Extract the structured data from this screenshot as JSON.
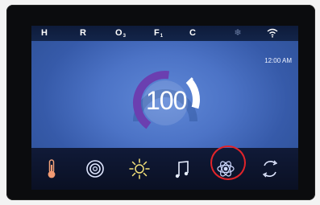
{
  "status_bar": {
    "h": "H",
    "r": "R",
    "o": "O",
    "o_sub": "3",
    "f": "F",
    "f_sub": "1",
    "c": "C",
    "snow_icon": "snowflake-icon",
    "wifi_icon": "wifi-icon"
  },
  "clock": {
    "time": "12:00 AM"
  },
  "temperature": {
    "value": "100",
    "gauge_level_percent": 60,
    "accent_color": "#6b3fb0"
  },
  "bottom_bar": {
    "buttons": [
      {
        "icon": "thermometer-icon"
      },
      {
        "icon": "target-icon"
      },
      {
        "icon": "sun-icon"
      },
      {
        "icon": "music-note-icon"
      },
      {
        "icon": "atom-settings-icon"
      },
      {
        "icon": "refresh-icon"
      }
    ],
    "highlighted_button_index": 4,
    "highlight_color": "#e2242a"
  }
}
